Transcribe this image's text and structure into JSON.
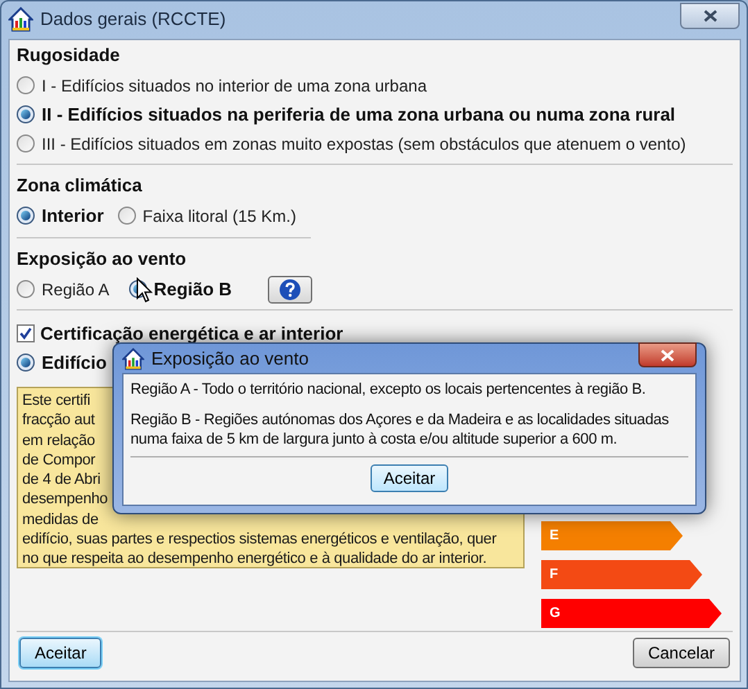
{
  "window": {
    "title": "Dados gerais (RCCTE)"
  },
  "rugosidade": {
    "title": "Rugosidade",
    "options": [
      {
        "label": "I - Edifícios situados no interior de uma zona urbana",
        "selected": false
      },
      {
        "label": "II - Edifícios situados na periferia de uma zona urbana ou numa zona rural",
        "selected": true
      },
      {
        "label": "III - Edifícios situados em zonas muito expostas (sem obstáculos que atenuem o vento)",
        "selected": false
      }
    ]
  },
  "zona_climatica": {
    "title": "Zona climática",
    "options": [
      {
        "label": "Interior",
        "selected": true
      },
      {
        "label": "Faixa litoral (15 Km.)",
        "selected": false
      }
    ]
  },
  "exposicao": {
    "title": "Exposição ao vento",
    "options": [
      {
        "label": "Região A",
        "selected": false
      },
      {
        "label": "Região B",
        "selected": true
      }
    ]
  },
  "certificacao": {
    "label": "Certificação energética e ar interior",
    "checked": true
  },
  "edificio": {
    "label": "Edifício",
    "selected": true
  },
  "info_lines": [
    "Este certifi",
    "fracção aut",
    "em relação",
    "de Compor",
    "de 4 de Abri",
    "desempenho",
    "medidas de",
    "edifício, suas partes e respectios sistemas energéticos e ventilação, quer",
    "no que respeita ao desempenho energético e à qualidade do ar interior."
  ],
  "energy_classes": [
    {
      "label": "E",
      "color": "#f47f00"
    },
    {
      "label": "F",
      "color": "#f34a14"
    },
    {
      "label": "G",
      "color": "#ff0000"
    }
  ],
  "buttons": [
    {
      "label": "Aceitar",
      "kind": "default"
    },
    {
      "label": "Cancelar",
      "kind": "normal"
    }
  ],
  "dialog": {
    "title": "Exposição ao vento",
    "paragraphs": [
      "Região A - Todo o território nacional, excepto os locais pertencentes à região B.",
      "Região B - Regiões autónomas dos Açores e da Madeira e as localidades situadas numa faixa de 5 km de largura junto à costa e/ou altitude superior a 600 m."
    ],
    "button": "Aceitar"
  }
}
